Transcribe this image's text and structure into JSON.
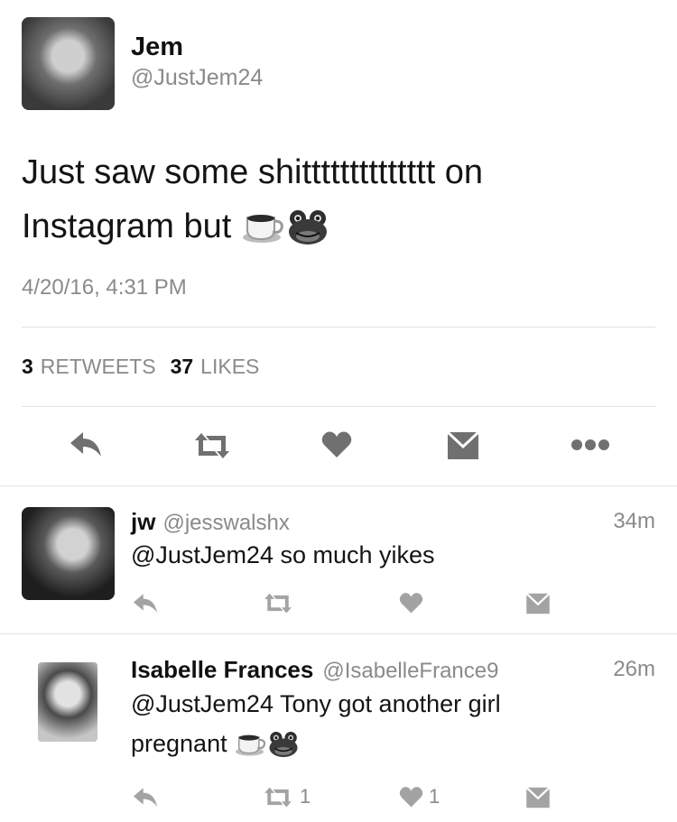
{
  "tweet": {
    "author_name": "Jem",
    "author_handle": "@JustJem24",
    "text_line1": "Just saw some shitttttttttttttt on",
    "text_line2": "Instagram but",
    "timestamp": "4/20/16, 4:31 PM",
    "retweets_count": "3",
    "retweets_label": "RETWEETS",
    "likes_count": "37",
    "likes_label": "LIKES"
  },
  "replies": [
    {
      "name": "jw",
      "handle": "@jesswalshx",
      "time": "34m",
      "text": "@JustJem24 so much yikes",
      "retweet_count": "",
      "like_count": ""
    },
    {
      "name": "Isabelle Frances",
      "handle": "@IsabelleFrance9",
      "time": "26m",
      "text_line1": "@JustJem24 Tony got another girl",
      "text_line2": "pregnant",
      "retweet_count": "1",
      "like_count": "1"
    }
  ],
  "icons": [
    "reply-icon",
    "retweet-icon",
    "heart-icon",
    "message-icon",
    "more-icon",
    "coffee-emoji",
    "frog-emoji"
  ]
}
